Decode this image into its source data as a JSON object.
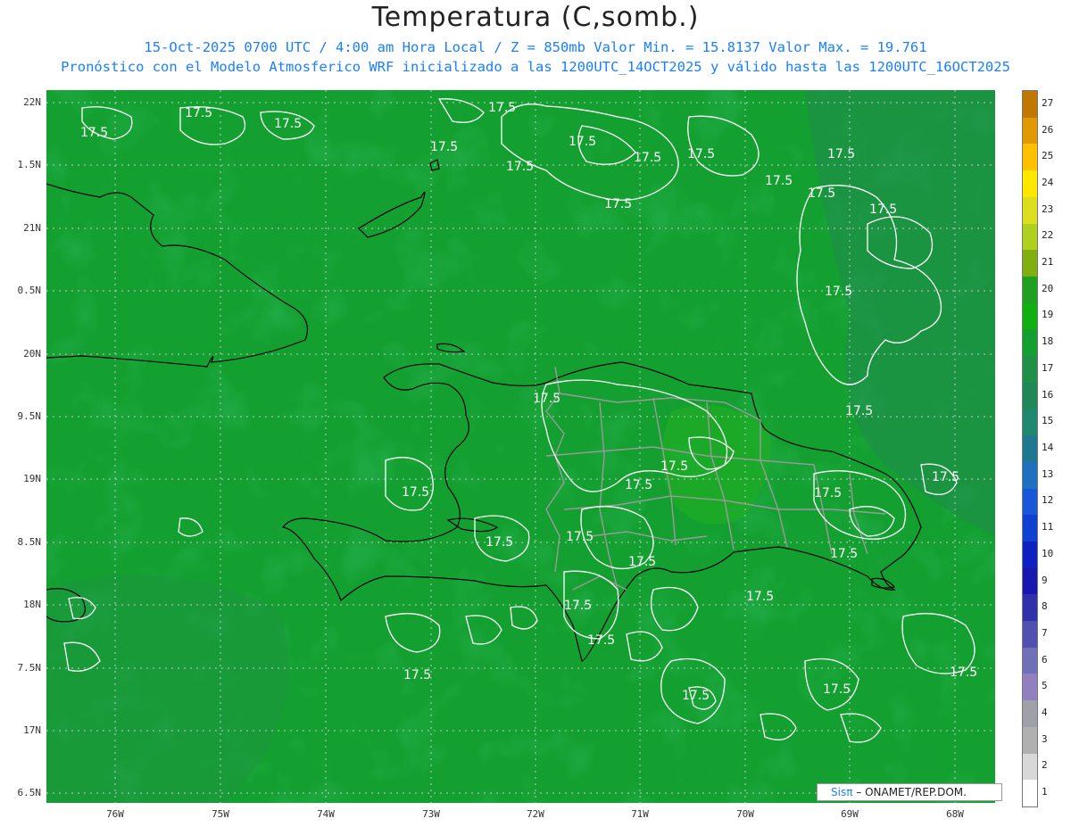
{
  "title": "Temperatura (C,somb.)",
  "subtitle_line1": "15-Oct-2025  0700 UTC / 4:00 am Hora Local / Z = 850mb    Valor Min. = 15.8137  Valor Max. = 19.761",
  "subtitle_line2": "Pronóstico con el Modelo Atmosferico WRF inicializado a las 1200UTC_14OCT2025 y válido hasta las  1200UTC_16OCT2025",
  "lat_labels": [
    "22N",
    "1.5N",
    "21N",
    "0.5N",
    "20N",
    "9.5N",
    "19N",
    "8.5N",
    "18N",
    "7.5N",
    "17N",
    "6.5N"
  ],
  "lon_labels": [
    "76W",
    "75W",
    "74W",
    "73W",
    "72W",
    "71W",
    "70W",
    "69W",
    "68W"
  ],
  "contour_label": "17.5",
  "colorbar": {
    "labels": [
      "27",
      "26",
      "25",
      "24",
      "23",
      "22",
      "21",
      "20",
      "19",
      "18",
      "17",
      "16",
      "15",
      "14",
      "13",
      "12",
      "11",
      "10",
      "9",
      "8",
      "7",
      "6",
      "5",
      "4",
      "3",
      "2",
      "1"
    ],
    "colors": [
      "#c07800",
      "#e09a00",
      "#ffc000",
      "#ffe800",
      "#dede20",
      "#b0d020",
      "#80b010",
      "#20a020",
      "#10b010",
      "#14a030",
      "#209048",
      "#208858",
      "#20886e",
      "#207890",
      "#2070c0",
      "#1858d8",
      "#1040d0",
      "#1020c0",
      "#1818b0",
      "#3030a8",
      "#5050b0",
      "#7070b8",
      "#9080c0",
      "#a0a0a8",
      "#b0b0b0",
      "#d8d8d8",
      "#ffffff"
    ]
  },
  "credit": {
    "brand": "Sisπ",
    "text": " – ONAMET/REP.DOM."
  }
}
